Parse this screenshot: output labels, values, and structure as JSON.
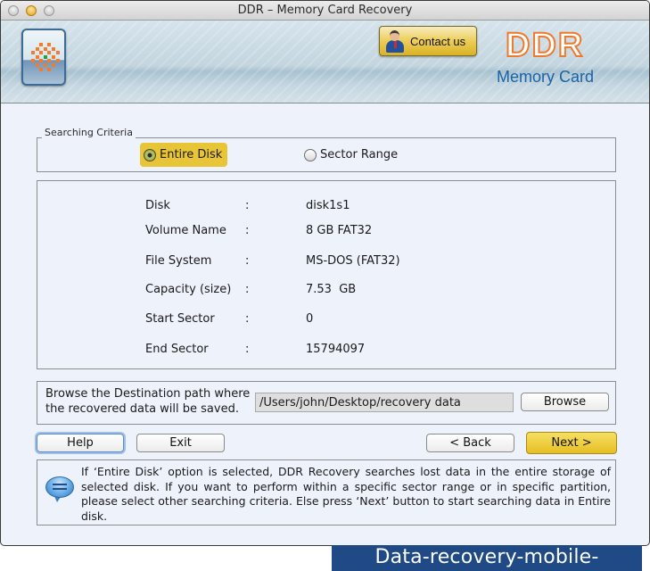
{
  "window": {
    "title": "DDR – Memory Card Recovery",
    "controls": [
      "close",
      "minimize",
      "zoom"
    ]
  },
  "banner": {
    "contact_label": "Contact us",
    "brand": "DDR",
    "brand_subtitle": "Memory Card",
    "brand_color": "#f07a2c",
    "subtitle_color": "#1a63a6"
  },
  "criteria": {
    "legend": "Searching Criteria",
    "options": [
      {
        "label": "Entire Disk",
        "selected": true
      },
      {
        "label": "Sector Range",
        "selected": false
      }
    ],
    "highlight_color": "#e8c437"
  },
  "disk_info": {
    "separator": ":",
    "rows": [
      {
        "key": "Disk",
        "value": "disk1s1"
      },
      {
        "key": "Volume Name",
        "value": "8 GB FAT32"
      },
      {
        "key": "File System",
        "value": "MS-DOS (FAT32)"
      },
      {
        "key": "Capacity (size)",
        "value": "7.53  GB"
      },
      {
        "key": "Start Sector",
        "value": "0"
      },
      {
        "key": "End Sector",
        "value": "15794097"
      }
    ]
  },
  "destination": {
    "label": "Browse the Destination path where the recovered data will be saved.",
    "path_value": "/Users/john/Desktop/recovery data",
    "browse_label": "Browse"
  },
  "actions": {
    "help": "Help",
    "exit": "Exit",
    "back": "< Back",
    "next": "Next >"
  },
  "hint": {
    "text": "If ‘Entire Disk’ option is selected, DDR Recovery searches lost data in the entire storage of selected disk. If you want to perform within a specific sector range or in specific partition, please select other searching criteria. Else press ‘Next’ button to start searching data in Entire disk."
  },
  "watermark": {
    "text": "Data-recovery-mobile-phone.com",
    "background": "#1f4a86"
  }
}
